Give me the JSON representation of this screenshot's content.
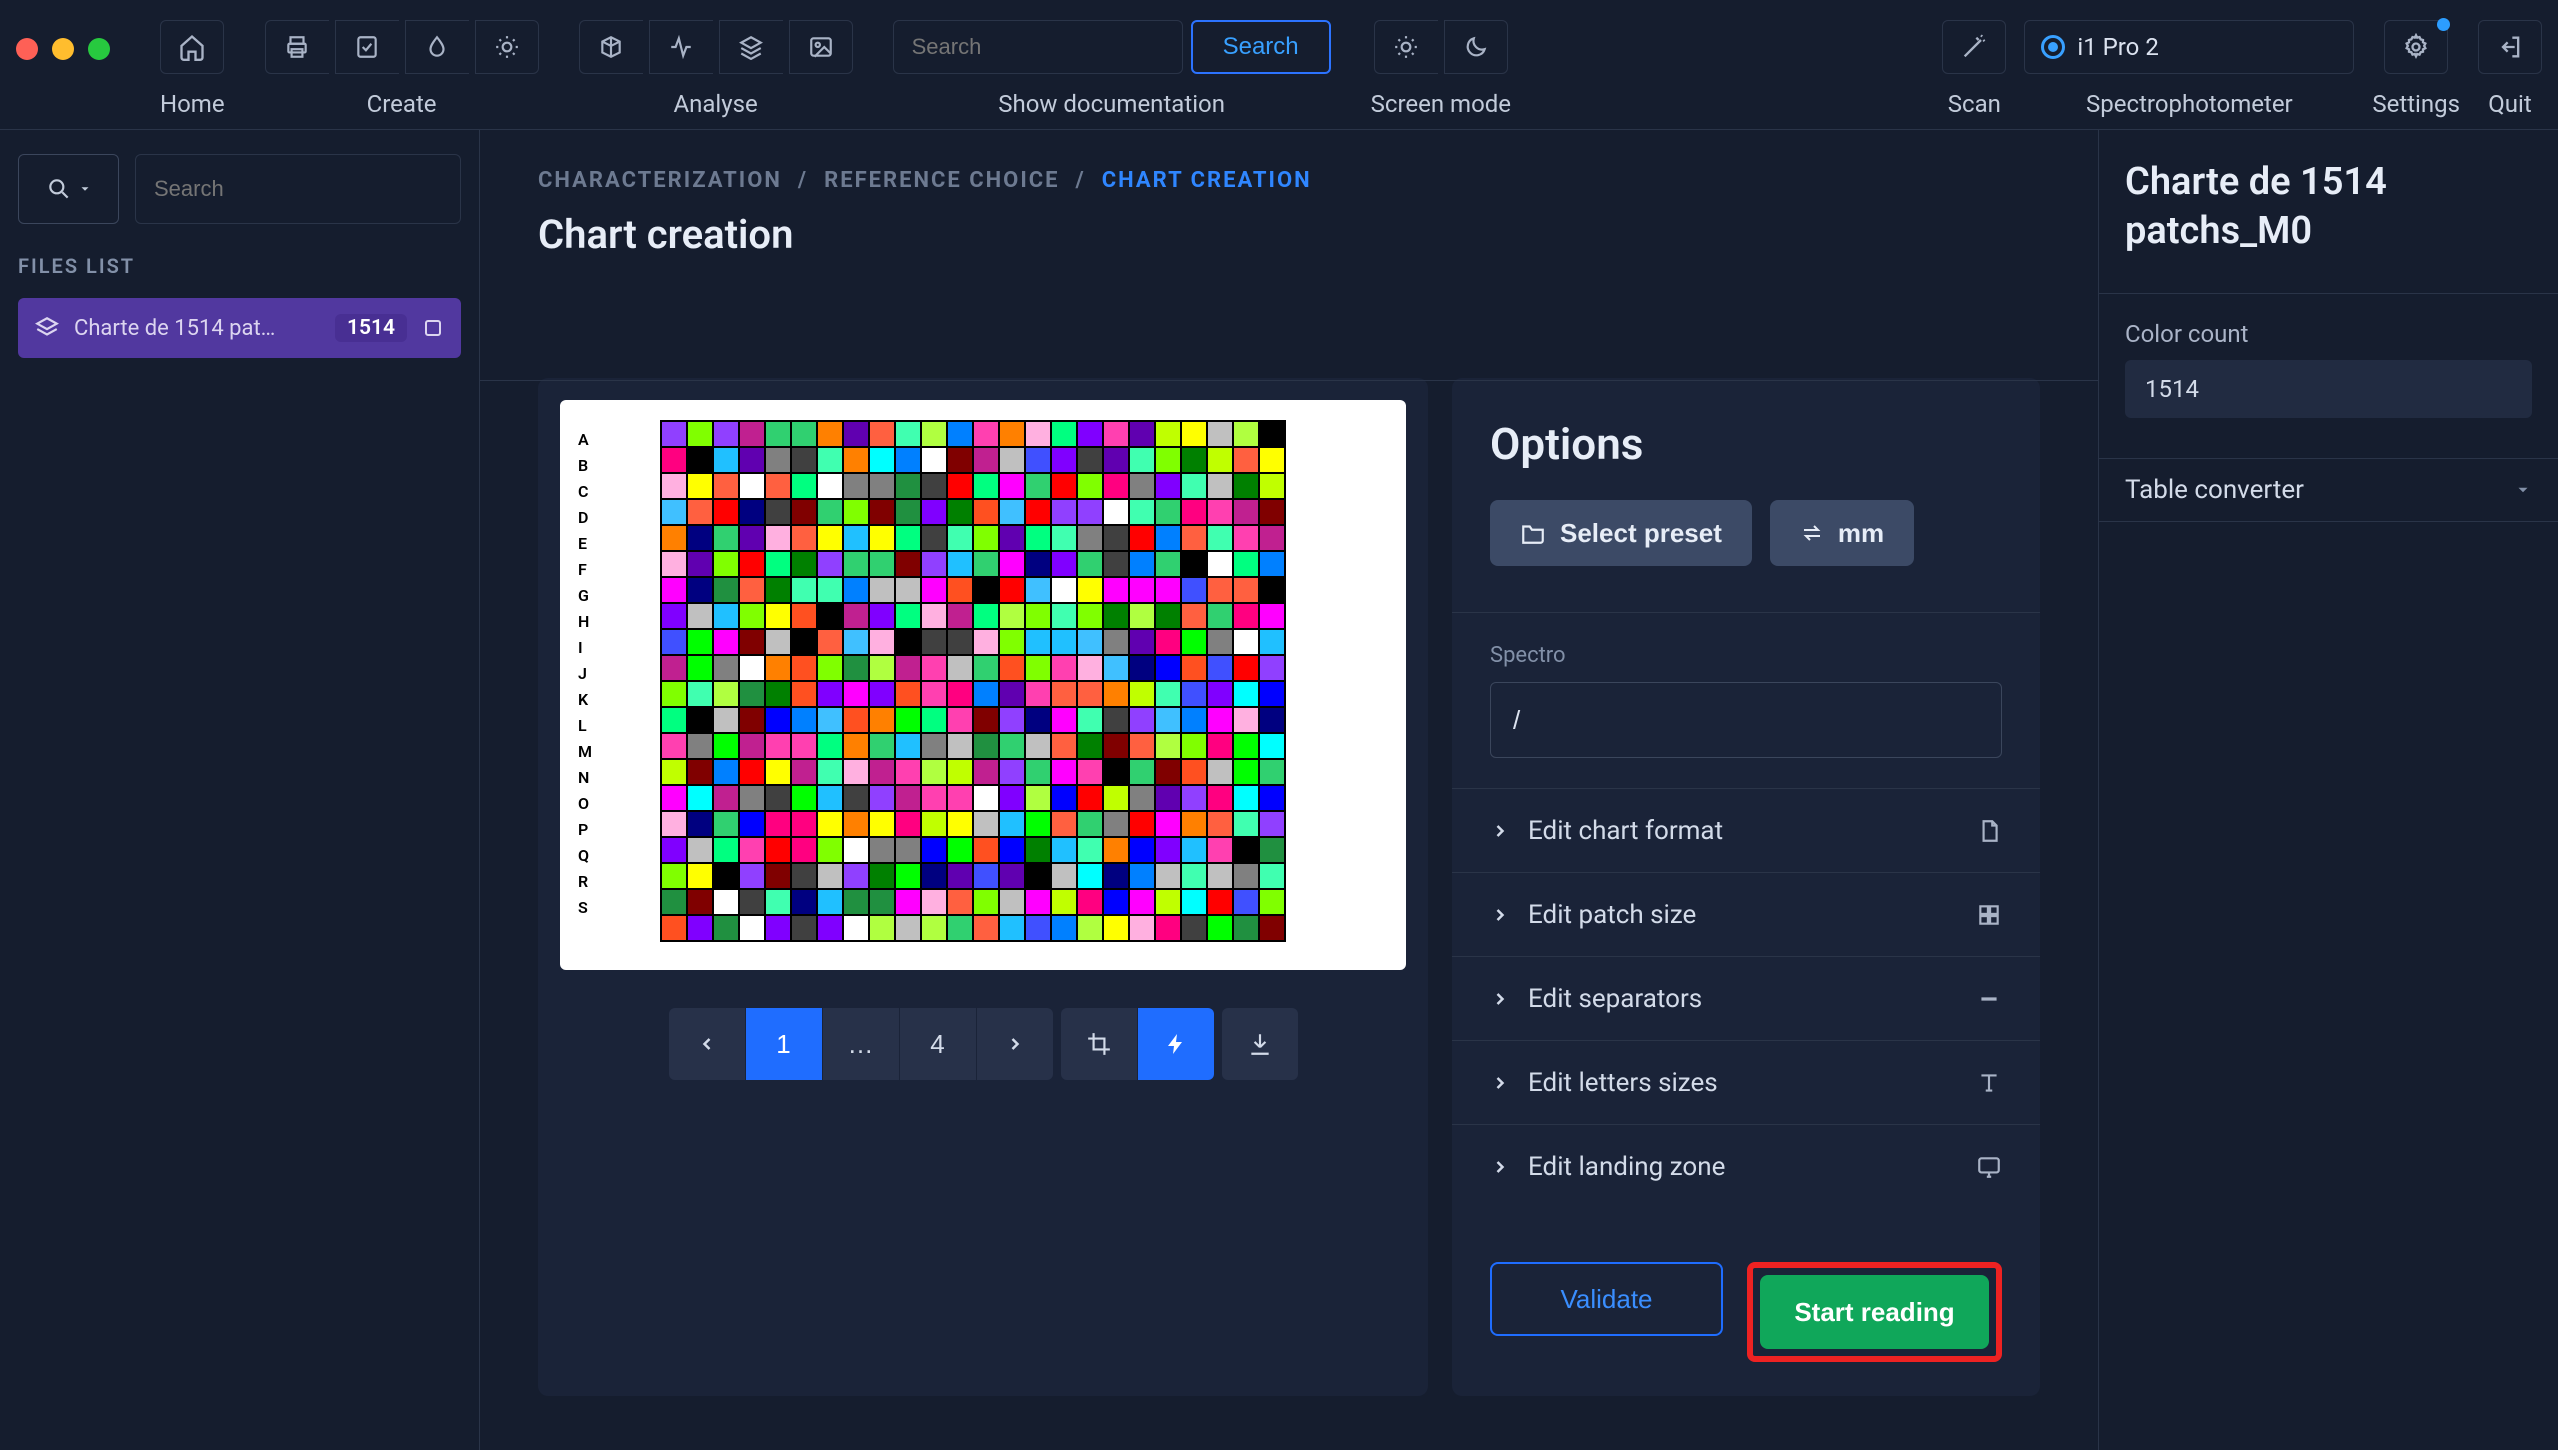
{
  "topbar": {
    "groups": {
      "home_label": "Home",
      "create_label": "Create",
      "analyse_label": "Analyse",
      "doc_label": "Show documentation",
      "screen_label": "Screen mode",
      "scan_label": "Scan",
      "spectro_label": "Spectrophotometer",
      "settings_label": "Settings",
      "quit_label": "Quit"
    },
    "search_placeholder": "Search",
    "search_button": "Search",
    "spectro_selected": "i1 Pro 2"
  },
  "sidebar_left": {
    "search_placeholder": "Search",
    "files_list_label": "FILES LIST",
    "file": {
      "name": "Charte de 1514 pat…",
      "badge": "1514"
    }
  },
  "breadcrumb": {
    "a": "CHARACTERIZATION",
    "b": "REFERENCE CHOICE",
    "c": "CHART CREATION"
  },
  "page_title": "Chart creation",
  "chart": {
    "row_letters": [
      "A",
      "B",
      "C",
      "D",
      "E",
      "F",
      "G",
      "H",
      "I",
      "J",
      "K",
      "L",
      "M",
      "N",
      "O",
      "P",
      "Q",
      "R",
      "S"
    ],
    "pager": {
      "page_current": "1",
      "ellipsis": "…",
      "page_last": "4"
    }
  },
  "options": {
    "title": "Options",
    "preset_btn": "Select preset",
    "unit_btn": "mm",
    "spectro_label": "Spectro",
    "spectro_value": "/",
    "acc": {
      "format": "Edit chart format",
      "patch": "Edit patch size",
      "sep": "Edit separators",
      "letters": "Edit letters sizes",
      "landing": "Edit landing zone"
    },
    "validate": "Validate",
    "start": "Start reading"
  },
  "sidebar_right": {
    "title": "Charte de 1514 patchs_M0",
    "color_count_label": "Color count",
    "color_count_value": "1514",
    "table_converter": "Table converter"
  },
  "patch_palette": [
    "#ff0000",
    "#00ff00",
    "#0000ff",
    "#ffff00",
    "#ff00ff",
    "#00ffff",
    "#ff8000",
    "#8000ff",
    "#00ff80",
    "#ff0080",
    "#80ff00",
    "#0080ff",
    "#000000",
    "#ffffff",
    "#808080",
    "#404040",
    "#c0c0c0",
    "#800000",
    "#008000",
    "#000080",
    "#ffb0e0",
    "#40c0ff",
    "#9040ff",
    "#30d070",
    "#ff6040",
    "#b0ff40",
    "#4050ff",
    "#ff40b0",
    "#40ffb0",
    "#c0ff00",
    "#6000b0",
    "#ff5020",
    "#20c0ff",
    "#209040",
    "#c02090"
  ]
}
